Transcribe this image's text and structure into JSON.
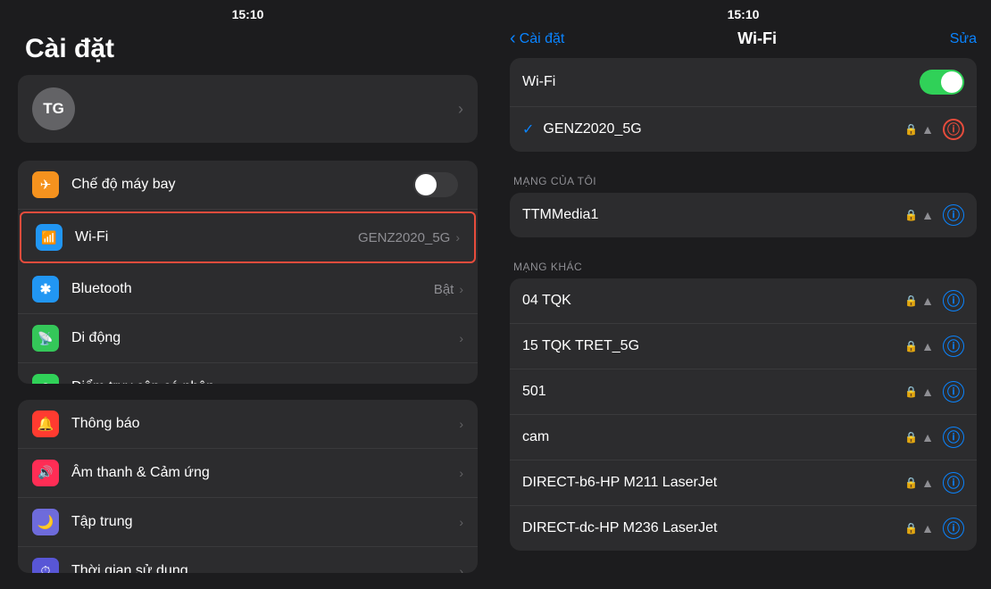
{
  "left": {
    "status_time": "15:10",
    "title": "Cài đặt",
    "profile_initials": "TG",
    "groups": [
      {
        "items": [
          {
            "id": "airplane",
            "icon": "✈",
            "icon_color": "orange",
            "label": "Chế độ máy bay",
            "value": "",
            "has_toggle": true,
            "toggle_on": false
          },
          {
            "id": "wifi",
            "icon": "📶",
            "icon_color": "blue",
            "label": "Wi-Fi",
            "value": "GENZ2020_5G",
            "highlighted": true
          },
          {
            "id": "bluetooth",
            "icon": "❋",
            "icon_color": "blue",
            "label": "Bluetooth",
            "value": "Bật"
          },
          {
            "id": "mobile",
            "icon": "📡",
            "icon_color": "green2",
            "label": "Di động",
            "value": ""
          },
          {
            "id": "hotspot",
            "icon": "⊕",
            "icon_color": "green3",
            "label": "Điểm truy cập cá nhân",
            "value": ""
          }
        ]
      },
      {
        "items": [
          {
            "id": "notifications",
            "icon": "🔔",
            "icon_color": "red",
            "label": "Thông báo",
            "value": ""
          },
          {
            "id": "sounds",
            "icon": "🔊",
            "icon_color": "pink",
            "label": "Âm thanh & Cảm ứng",
            "value": ""
          },
          {
            "id": "focus",
            "icon": "🌙",
            "icon_color": "indigo",
            "label": "Tập trung",
            "value": ""
          },
          {
            "id": "screentime",
            "icon": "⏱",
            "icon_color": "purple",
            "label": "Thời gian sử dụng",
            "value": ""
          }
        ]
      }
    ]
  },
  "right": {
    "status_time": "15:10",
    "back_label": "Cài đặt",
    "title": "Wi-Fi",
    "edit_label": "Sửa",
    "top_section": {
      "wifi_label": "Wi-Fi",
      "wifi_on": true,
      "connected_network": "GENZ2020_5G"
    },
    "my_network_label": "MẠNG CỦA TÔI",
    "my_networks": [
      {
        "ssid": "TTMMedia1"
      }
    ],
    "other_network_label": "MẠNG KHÁC",
    "other_networks": [
      {
        "ssid": "04 TQK",
        "sub": ""
      },
      {
        "ssid": "15 TQK TRET_5G",
        "sub": ""
      },
      {
        "ssid": "501",
        "sub": ""
      },
      {
        "ssid": "cam",
        "sub": ""
      },
      {
        "ssid": "DIRECT-b6-HP M211 LaserJet",
        "sub": "M211 LaserJet"
      },
      {
        "ssid": "DIRECT-dc-HP M236 LaserJet",
        "sub": "M236 LaserJet"
      }
    ]
  }
}
